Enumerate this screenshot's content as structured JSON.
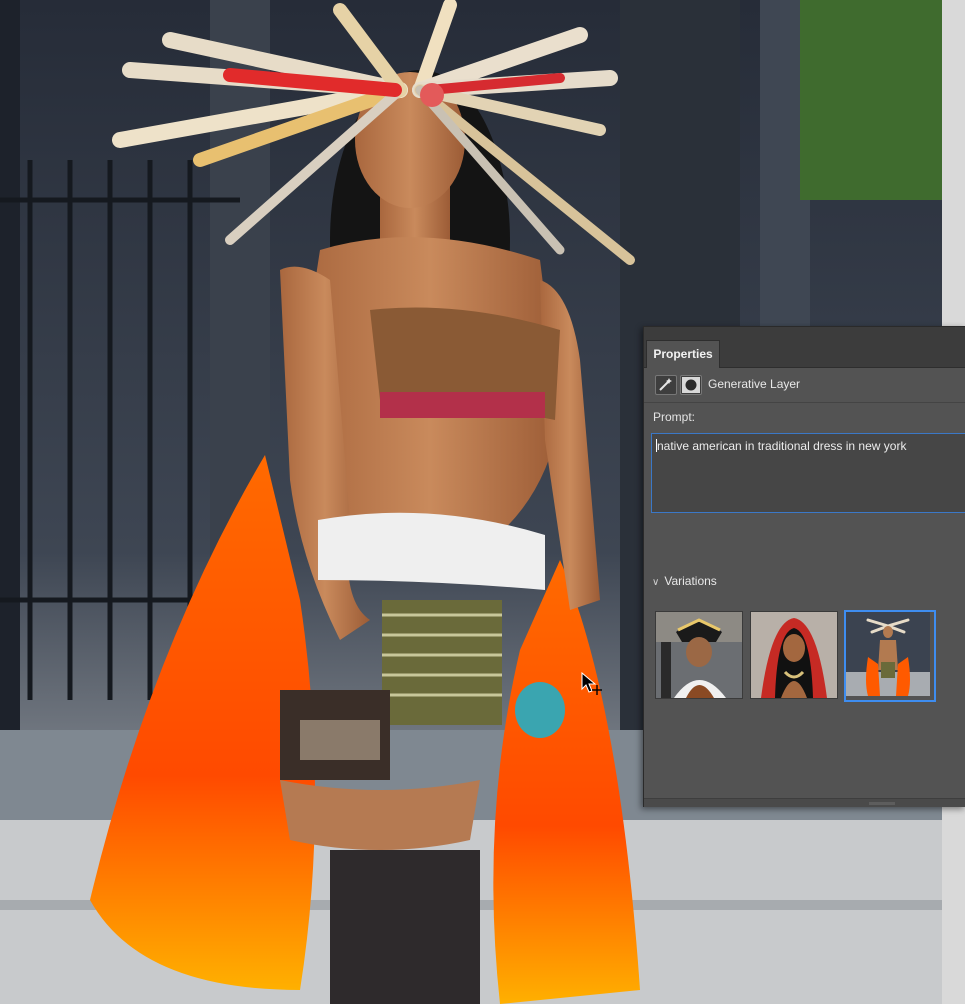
{
  "properties_panel": {
    "tab_label": "Properties",
    "layer_label": "Generative Layer",
    "prompt_label": "Prompt:",
    "prompt_value": "native american in traditional dress in new york",
    "variations_label": "Variations",
    "variations": [
      {
        "icon": "variation-thumbnail",
        "selected": false
      },
      {
        "icon": "variation-thumbnail",
        "selected": false
      },
      {
        "icon": "variation-thumbnail",
        "selected": true
      }
    ]
  },
  "colors": {
    "panel_bg": "#535353",
    "tab_bar_bg": "#3c3c3c",
    "accent": "#3b78c7",
    "selected_border": "#3e8df0"
  },
  "icons": [
    "generative-layer-icon",
    "layer-mask-icon",
    "chevron-down-icon",
    "move-cursor-icon"
  ]
}
